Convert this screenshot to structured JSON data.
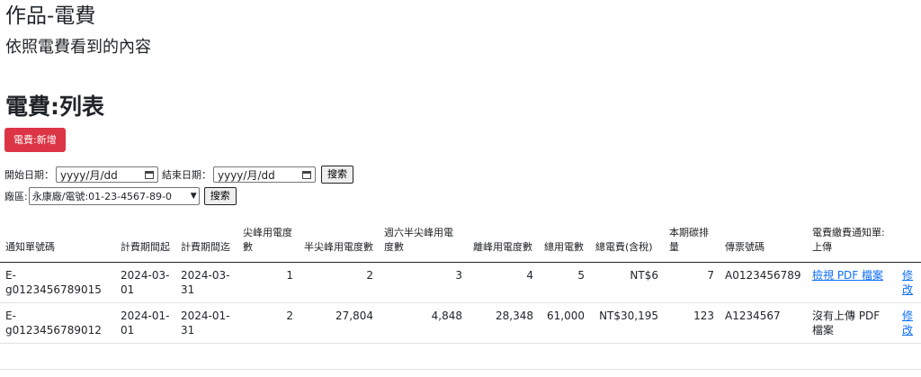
{
  "page": {
    "title": "作品-電費",
    "subtitle": "依照電費看到的內容",
    "section_title": "電費:列表"
  },
  "actions": {
    "add_label": "電費:新增"
  },
  "filters": {
    "start_label": "開始日期：",
    "start_placeholder": "yyyy/月/dd",
    "end_label": "結束日期：",
    "end_placeholder": "yyyy/月/dd",
    "search_label": "搜索",
    "plant_label": "廠區:",
    "plant_selected": "永康廠/電號:01-23-4567-89-0",
    "search2_label": "搜索"
  },
  "table": {
    "headers": [
      "通知單號碼",
      "計費期間起",
      "計費期間迄",
      "尖峰用電度數",
      "半尖峰用電度數",
      "週六半尖峰用電度數",
      "離峰用電度數",
      "總用電數",
      "總電費(含稅)",
      "本期碳排量",
      "傳票號碼",
      "電費繳費通知單:上傳",
      ""
    ],
    "rows": [
      {
        "notice_no": "E-g0123456789015",
        "start": "2024-03-01",
        "end": "2024-03-31",
        "peak": "1",
        "half_peak": "2",
        "sat_half_peak": "3",
        "off_peak": "4",
        "total_kwh": "5",
        "total_fee": "NT$6",
        "carbon": "7",
        "voucher": "A0123456789",
        "upload": "檢視 PDF 檔案",
        "edit": "修改"
      },
      {
        "notice_no": "E-g0123456789012",
        "start": "2024-01-01",
        "end": "2024-01-31",
        "peak": "2",
        "half_peak": "27,804",
        "sat_half_peak": "4,848",
        "off_peak": "28,348",
        "total_kwh": "61,000",
        "total_fee": "NT$30,195",
        "carbon": "123",
        "voucher": "A1234567",
        "upload": "沒有上傳 PDF 檔案",
        "edit": "修改"
      }
    ]
  },
  "colors": {
    "primary_red": "#dc3545",
    "link_blue": "#0d6efd"
  }
}
